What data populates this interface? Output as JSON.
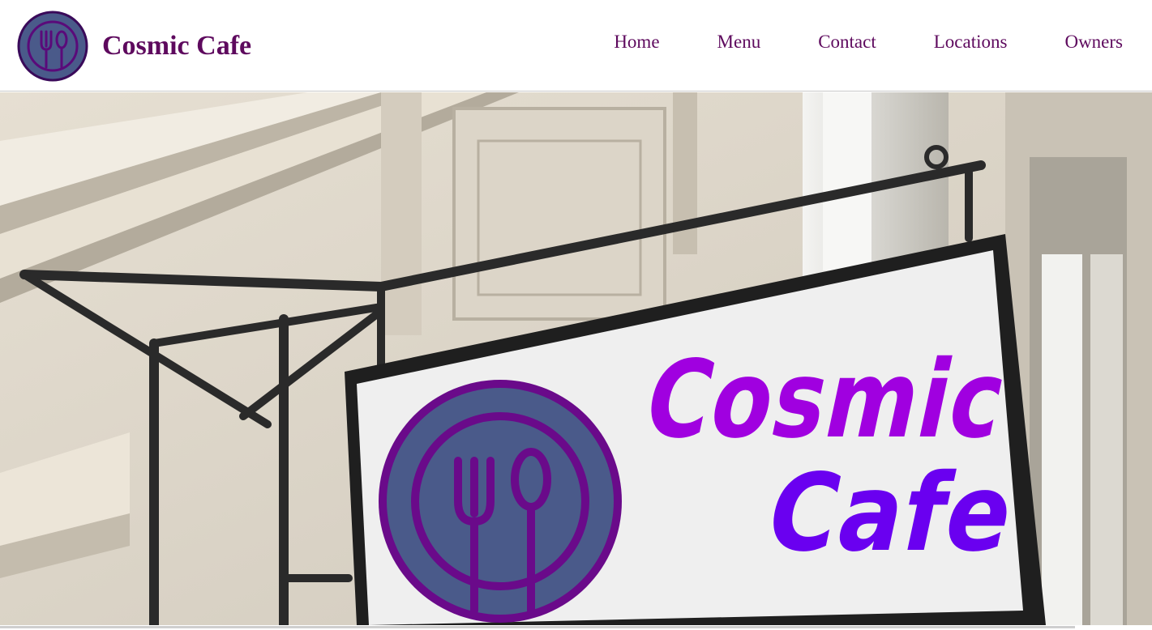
{
  "header": {
    "brand_title": "Cosmic Cafe",
    "logo_icon": "fork-spoon-plate-icon",
    "nav": [
      {
        "label": "Home"
      },
      {
        "label": "Menu"
      },
      {
        "label": "Contact"
      },
      {
        "label": "Locations"
      },
      {
        "label": "Owners"
      }
    ]
  },
  "hero": {
    "sign_text_line1": "Cosmic",
    "sign_text_line2": "Cafe",
    "sign_icon": "fork-spoon-plate-icon"
  },
  "colors": {
    "brand_text": "#5e0a5e",
    "logo_fill": "#4a5a8a",
    "logo_ring": "#5a0a7a",
    "sign_magenta": "#a000e0",
    "sign_violet": "#6a00f0"
  }
}
